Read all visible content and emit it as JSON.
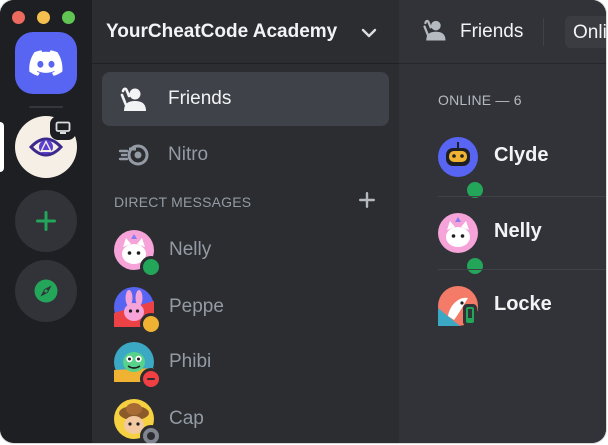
{
  "window": {
    "traffic_lights": [
      "close",
      "minimize",
      "maximize"
    ]
  },
  "rail": {
    "home_icon": "discord-logo-icon",
    "server_icon": "eye-logo-icon",
    "server_badge_icon": "monitor-icon",
    "add_icon": "plus-icon",
    "explore_icon": "compass-icon"
  },
  "sidebar": {
    "server_name": "YourCheatCode Academy",
    "nav": [
      {
        "label": "Friends",
        "icon": "friends-wave-icon"
      },
      {
        "label": "Nitro",
        "icon": "nitro-icon"
      }
    ],
    "dm_header": "DIRECT MESSAGES",
    "dms": [
      {
        "name": "Nelly",
        "status": "online"
      },
      {
        "name": "Peppe",
        "status": "idle"
      },
      {
        "name": "Phibi",
        "status": "dnd"
      },
      {
        "name": "Cap",
        "status": "offline"
      }
    ]
  },
  "main": {
    "header_title": "Friends",
    "header_tab": "Online",
    "online_header": "ONLINE — 6",
    "friends": [
      {
        "name": "Clyde",
        "status": "online"
      },
      {
        "name": "Nelly",
        "status": "online"
      },
      {
        "name": "Locke",
        "status": "mobile"
      }
    ]
  },
  "colors": {
    "blurple": "#5865f2",
    "online": "#23a55a",
    "idle": "#f0b232",
    "dnd": "#f23f43",
    "offline": "#80848e",
    "rail_bg": "#1e1f22",
    "sidebar_bg": "#2b2d31",
    "main_bg": "#313338"
  }
}
